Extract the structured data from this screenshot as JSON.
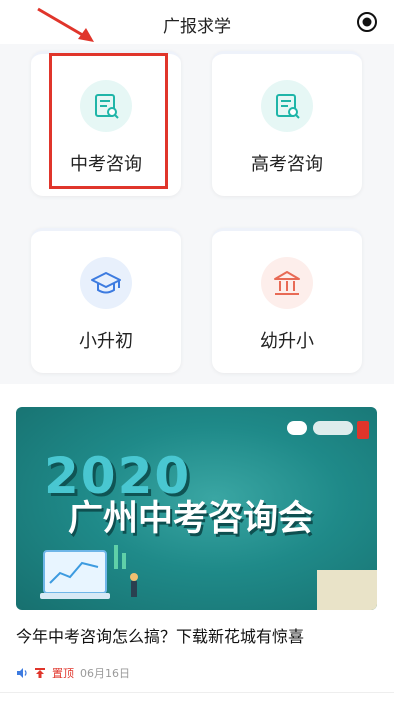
{
  "header": {
    "title": "广报求学",
    "target_icon": "target-icon"
  },
  "cards": [
    {
      "label": "中考咨询",
      "icon": "exam-doc-icon",
      "accent": "#1fb5a8",
      "bg": "#e6f7f5"
    },
    {
      "label": "高考咨询",
      "icon": "exam-doc-icon",
      "accent": "#1fb5a8",
      "bg": "#e6f7f5"
    },
    {
      "label": "小升初",
      "icon": "graduation-cap-icon",
      "accent": "#3d7be0",
      "bg": "#e8f0fc"
    },
    {
      "label": "幼升小",
      "icon": "building-icon",
      "accent": "#e86a55",
      "bg": "#fdeeeb"
    }
  ],
  "annotation": {
    "highlight_color": "#e0352b"
  },
  "banner": {
    "year": "2020",
    "title": "广州中考咨询会"
  },
  "article": {
    "title": "今年中考咨询怎么搞？下载新花城有惊喜",
    "pin_label": "置顶",
    "date": "06月16日"
  }
}
